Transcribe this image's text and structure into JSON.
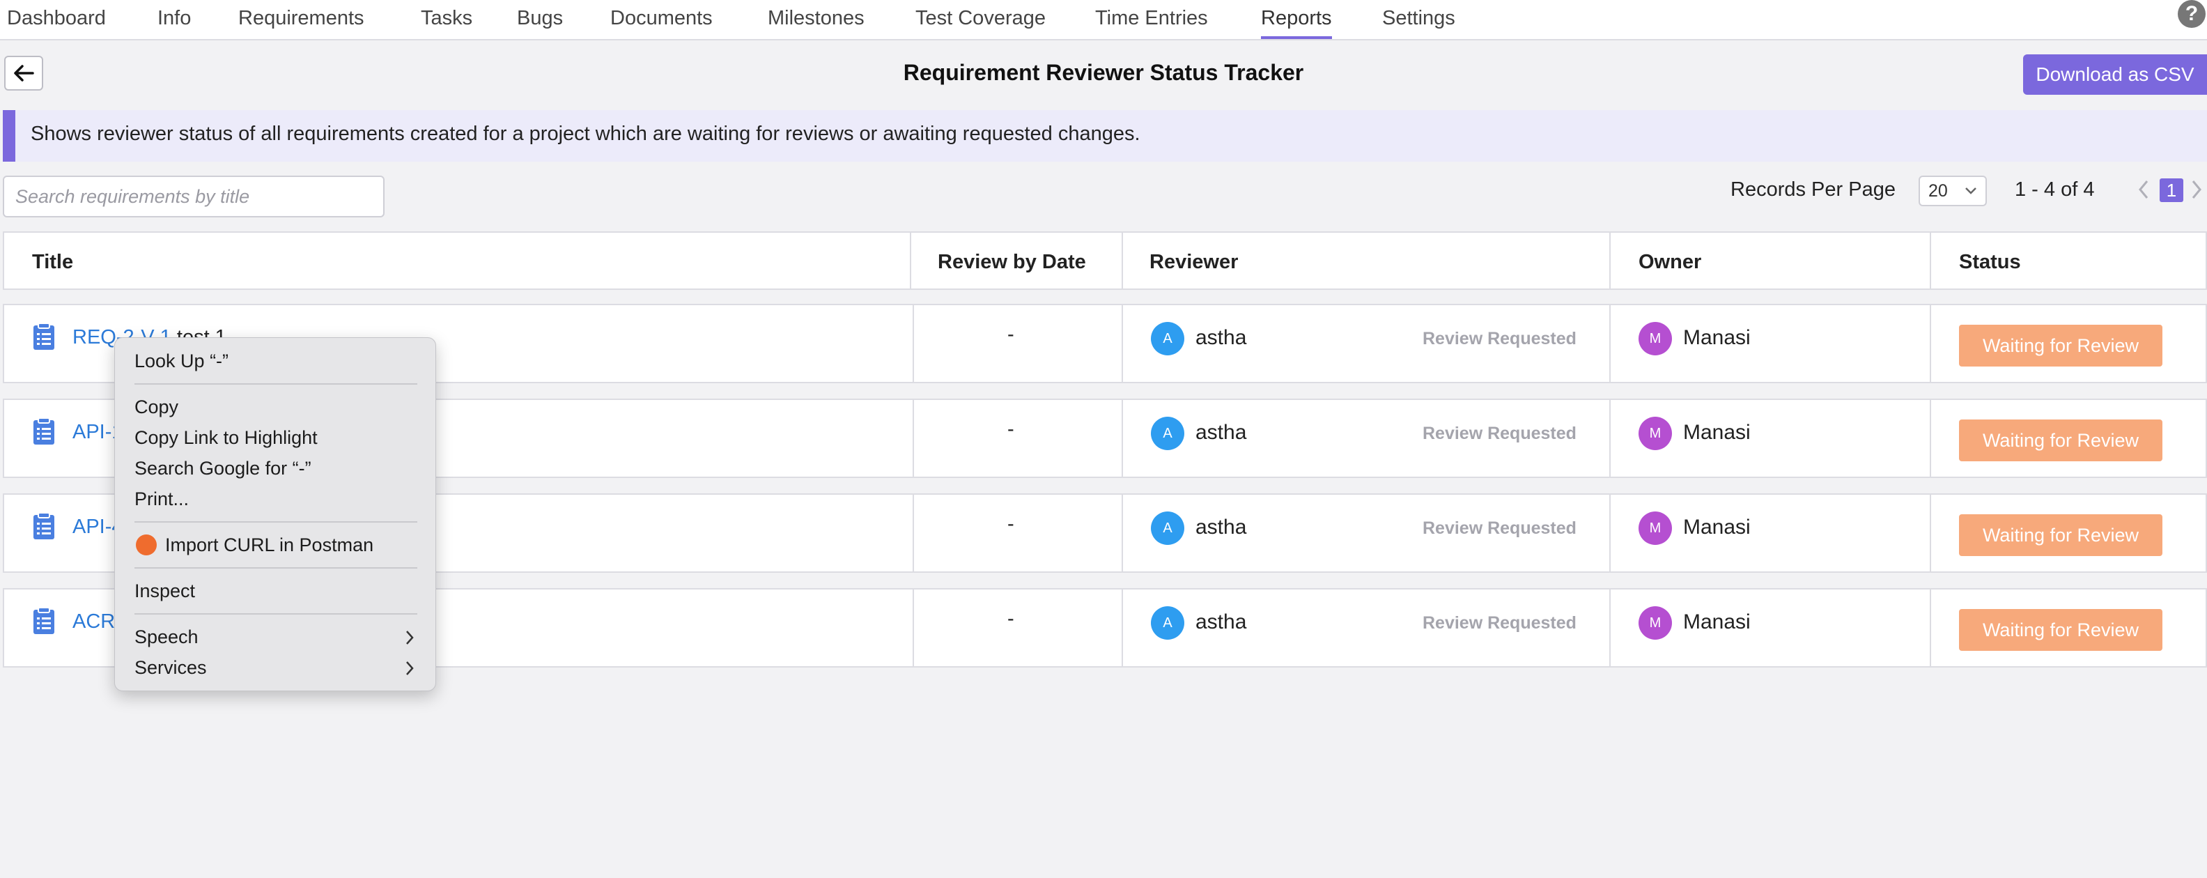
{
  "nav": {
    "tabs": [
      {
        "label": "Dashboard"
      },
      {
        "label": "Info"
      },
      {
        "label": "Requirements"
      },
      {
        "label": "Tasks"
      },
      {
        "label": "Bugs"
      },
      {
        "label": "Documents"
      },
      {
        "label": "Milestones"
      },
      {
        "label": "Test Coverage"
      },
      {
        "label": "Time Entries"
      },
      {
        "label": "Reports"
      },
      {
        "label": "Settings"
      }
    ],
    "active_tab": "Reports",
    "help_label": "?"
  },
  "header": {
    "title": "Requirement Reviewer Status Tracker",
    "download_label": "Download as CSV"
  },
  "banner": {
    "text": "Shows reviewer status of all requirements created for a project which are waiting for reviews or awaiting requested changes."
  },
  "search": {
    "placeholder": "Search requirements by title",
    "value": ""
  },
  "pagination": {
    "records_per_page_label": "Records Per Page",
    "records_per_page": "20",
    "range_text": "1 - 4  of  4",
    "current_page": "1"
  },
  "table": {
    "columns": [
      "Title",
      "Review by Date",
      "Reviewer",
      "Owner",
      "Status"
    ],
    "rows": [
      {
        "title_link": "REQ-2-V-1",
        "title_rest": " test 1",
        "review_by_date": "-",
        "reviewer_initial": "A",
        "reviewer": "astha",
        "review_status": "Review Requested",
        "owner_initial": "M",
        "owner": "Manasi",
        "status": "Waiting for Review"
      },
      {
        "title_link": "API-1",
        "title_rest": "",
        "review_by_date": "-",
        "reviewer_initial": "A",
        "reviewer": "astha",
        "review_status": "Review Requested",
        "owner_initial": "M",
        "owner": "Manasi",
        "status": "Waiting for Review"
      },
      {
        "title_link": "API-4",
        "title_rest": "",
        "review_by_date": "-",
        "reviewer_initial": "A",
        "reviewer": "astha",
        "review_status": "Review Requested",
        "owner_initial": "M",
        "owner": "Manasi",
        "status": "Waiting for Review"
      },
      {
        "title_link": "ACR",
        "title_rest": "",
        "review_by_date": "-",
        "reviewer_initial": "A",
        "reviewer": "astha",
        "review_status": "Review Requested",
        "owner_initial": "M",
        "owner": "Manasi",
        "status": "Waiting for Review"
      }
    ]
  },
  "context_menu": {
    "look_up": "Look Up “-”",
    "copy": "Copy",
    "copy_link": "Copy Link to Highlight",
    "search_google": "Search Google for “-”",
    "print": "Print...",
    "import_curl": "Import CURL in Postman",
    "inspect": "Inspect",
    "speech": "Speech",
    "services": "Services"
  },
  "colors": {
    "accent": "#7b68dd",
    "link": "#2b7ad8",
    "status_badge": "#f7a97b",
    "reviewer_avatar": "#2e9df0",
    "owner_avatar": "#b54fd1",
    "postman": "#ef6c2e"
  }
}
